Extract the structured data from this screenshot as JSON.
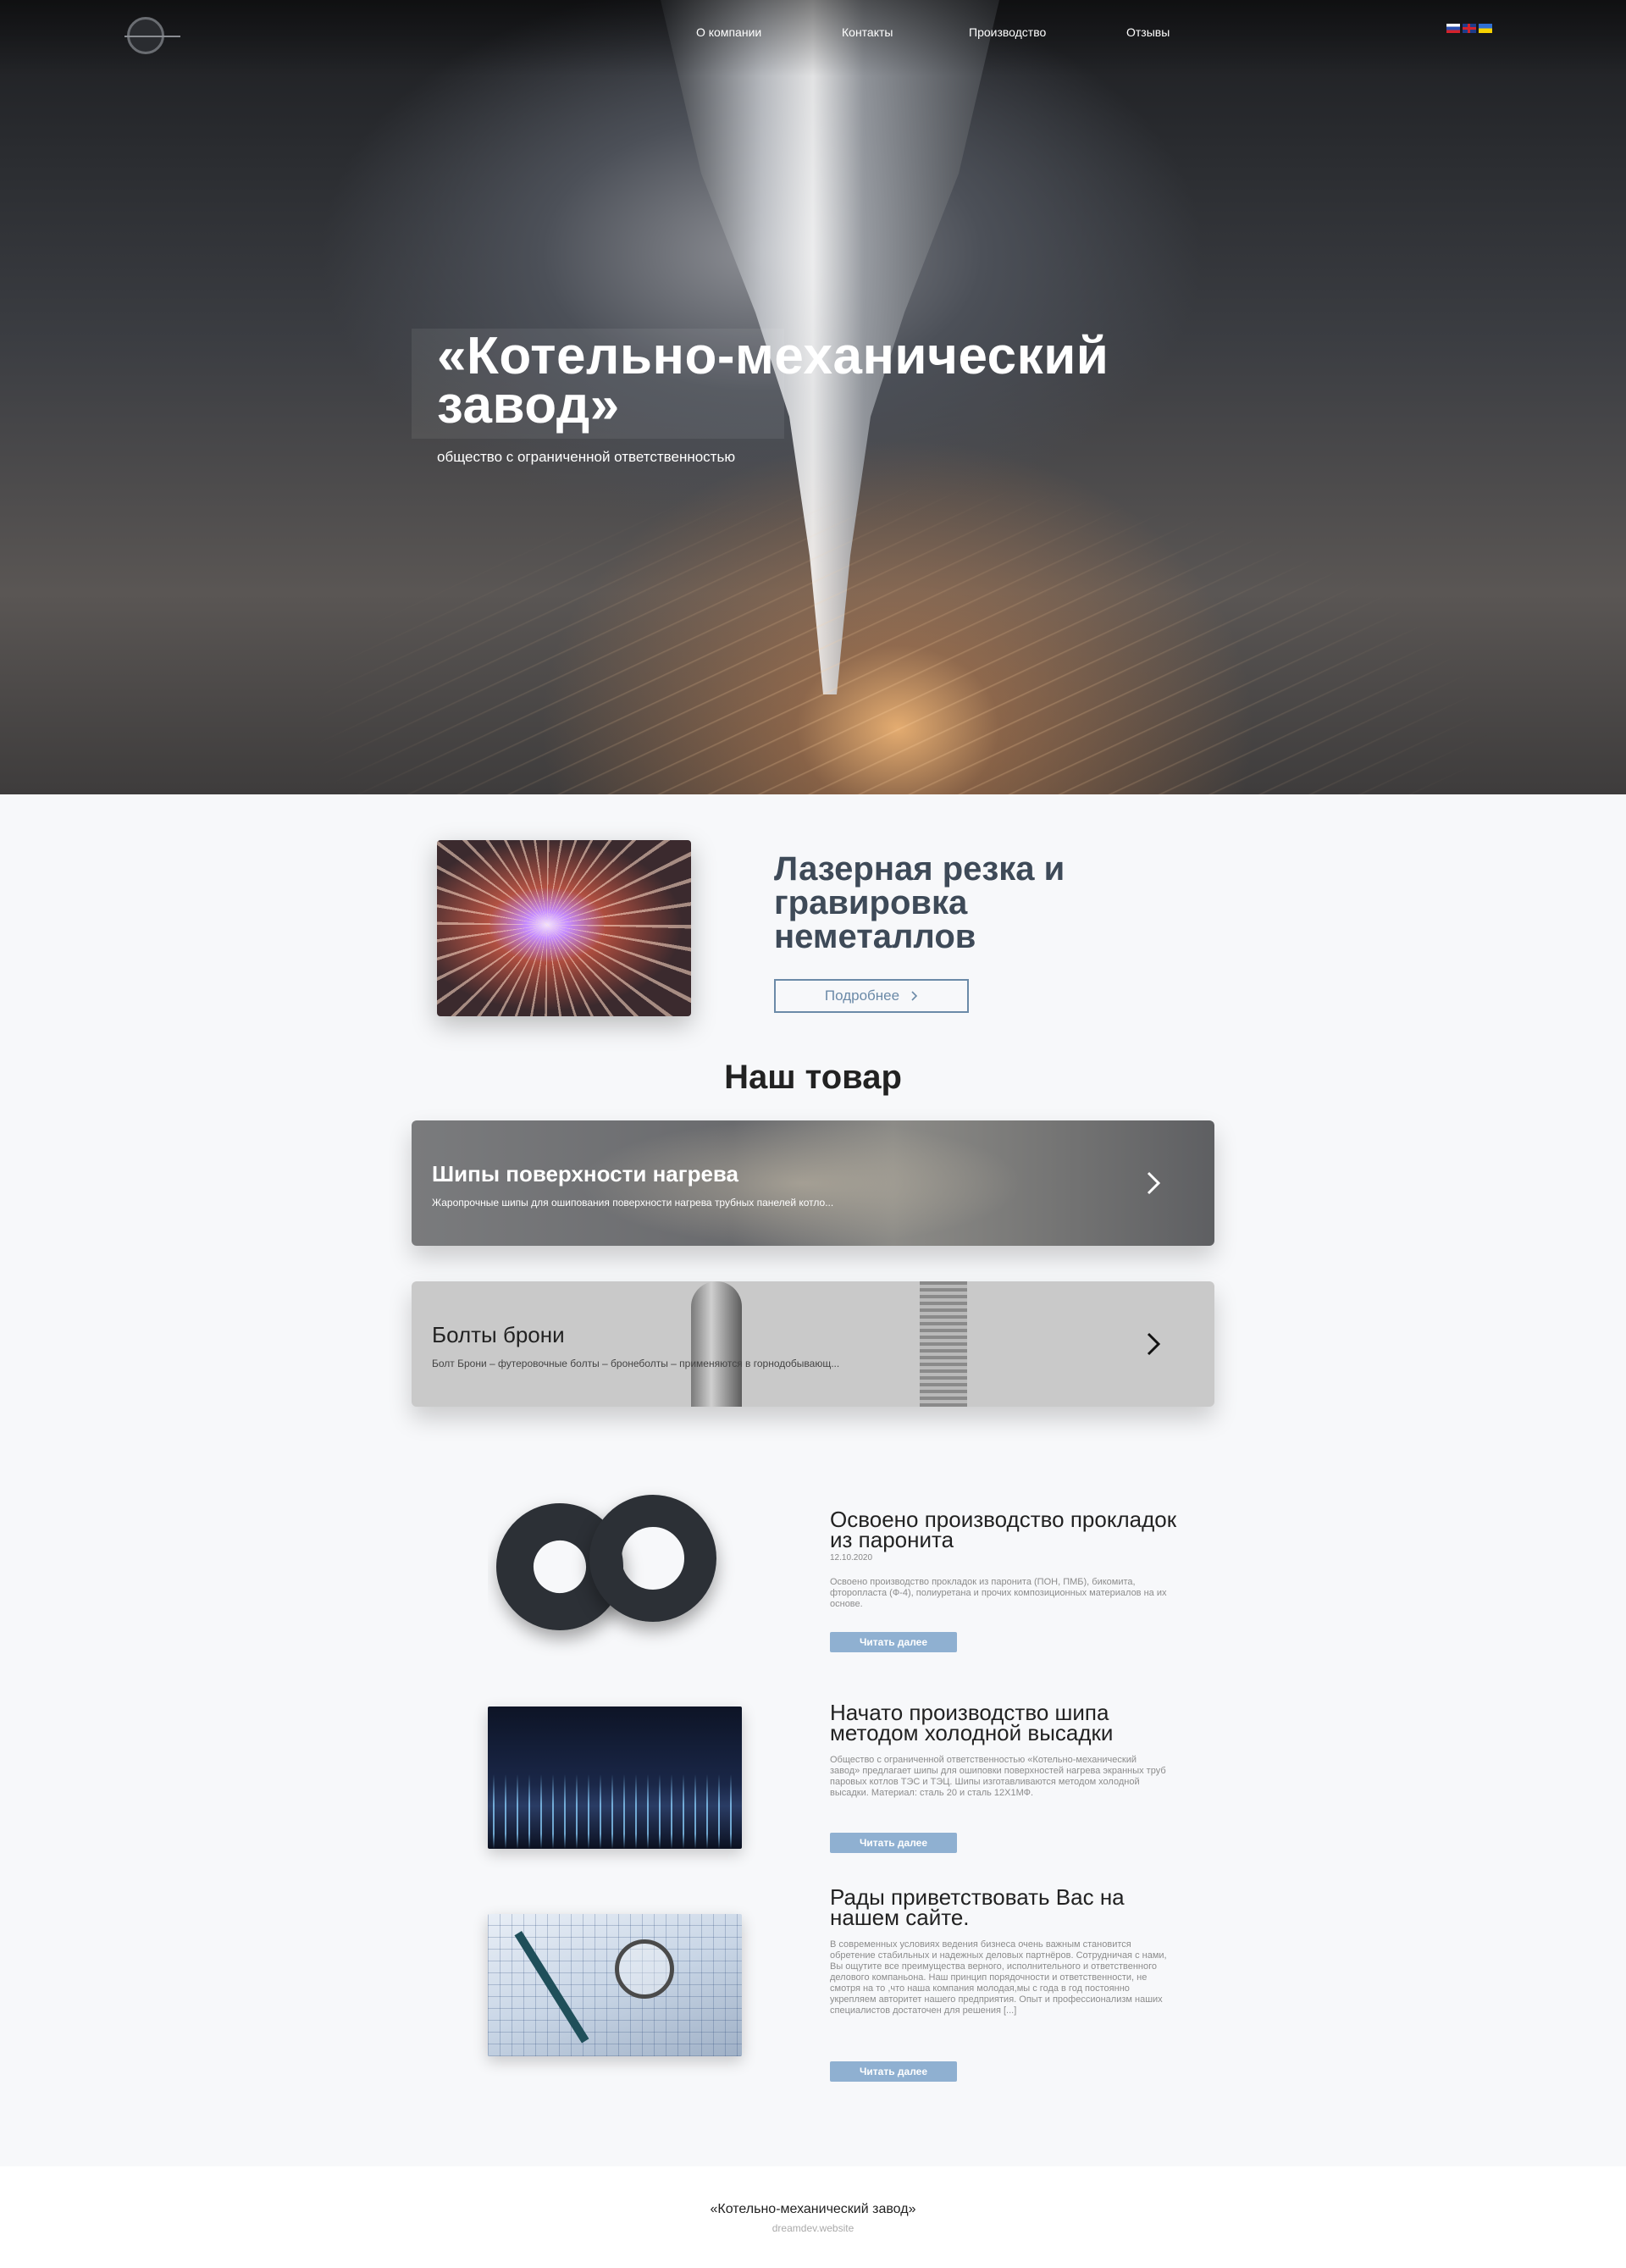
{
  "nav": {
    "items": [
      "О компании",
      "Контакты",
      "Производство",
      "Отзывы"
    ],
    "languages": [
      "ru-flag-icon",
      "en-flag-icon",
      "ua-flag-icon"
    ]
  },
  "hero": {
    "title": "«Котельно-механический завод»",
    "subtitle": "общество с ограниченной ответственностью"
  },
  "feature": {
    "title": "Лазерная резка и гравировка неметаллов",
    "button": "Подробнее"
  },
  "products": {
    "heading": "Наш товар",
    "items": [
      {
        "title": "Шипы поверхности нагрева",
        "description": "Жаропрочные шипы для ошипования поверхности нагрева трубных панелей котло..."
      },
      {
        "title": "Болты брони",
        "description": "Болт Брони – футеровочные болты – бронеболты – применяются в горнодобывающ..."
      }
    ]
  },
  "news": [
    {
      "title": "Освоено производство прокладок из паронита",
      "date": "12.10.2020",
      "text": "Освоено производство прокладок из паронита (ПОН, ПМБ), бикомита, фторопласта (Ф-4), полиуретана и прочих композиционных материалов на их основе.",
      "button": "Читать далее"
    },
    {
      "title": "Начато производство шипа методом холодной высадки",
      "date": "",
      "text": "Общество с ограниченной ответственностью «Котельно-механический завод» предлагает шипы для ошиповки поверхностей нагрева экранных труб паровых котлов ТЭС и ТЭЦ. Шипы изготавливаются методом холодной высадки. Материал: сталь 20 и сталь 12Х1МФ.",
      "button": "Читать далее"
    },
    {
      "title": "Рады приветствовать Вас на нашем сайте.",
      "date": "",
      "text": "В современных условиях ведения бизнеса очень важным становится обретение стабильных и надежных деловых партнёров. Сотрудничая с нами, Вы ощутите все преимущества верного, исполнительного и ответственного делового компаньона. Наш принцип порядочности и ответственности, не смотря на то ,что наша компания молодая,мы с года в год постоянно укрепляем авторитет нашего предприятия. Опыт и профессионализм наших специалистов достаточен для решения [...]",
      "button": "Читать далее"
    }
  ],
  "footer": {
    "company": "«Котельно-механический завод»",
    "credit": "dreamdev.website"
  },
  "colors": {
    "accent": "#6b8aa8",
    "read_button": "#8fb0d1",
    "feature_title": "#3e4a58"
  }
}
